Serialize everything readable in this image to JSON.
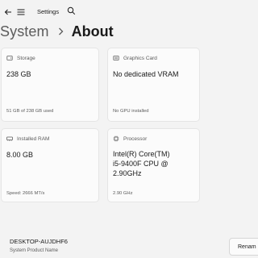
{
  "titlebar": {
    "app_title": "Settings"
  },
  "breadcrumb": {
    "parent": "System",
    "current": "About"
  },
  "cards": {
    "storage": {
      "label": "Storage",
      "value": "238 GB",
      "detail": "51 GB of 238 GB used",
      "icon": "storage-icon"
    },
    "graphics": {
      "label": "Graphics Card",
      "value": "No dedicated VRAM",
      "detail": "No GPU installed",
      "icon": "graphics-card-icon"
    },
    "ram": {
      "label": "Installed RAM",
      "value": "8.00 GB",
      "detail": "Speed: 2666 MT/s",
      "icon": "ram-icon"
    },
    "processor": {
      "label": "Processor",
      "value_lines": [
        "Intel(R) Core(TM)",
        "i5-9400F CPU @",
        "2.90GHz"
      ],
      "detail": "2.90 GHz",
      "icon": "processor-icon"
    }
  },
  "device": {
    "name": "DESKTOP-AUJDHF6",
    "subtitle": "System Product Name",
    "rename_label": "Renam"
  }
}
